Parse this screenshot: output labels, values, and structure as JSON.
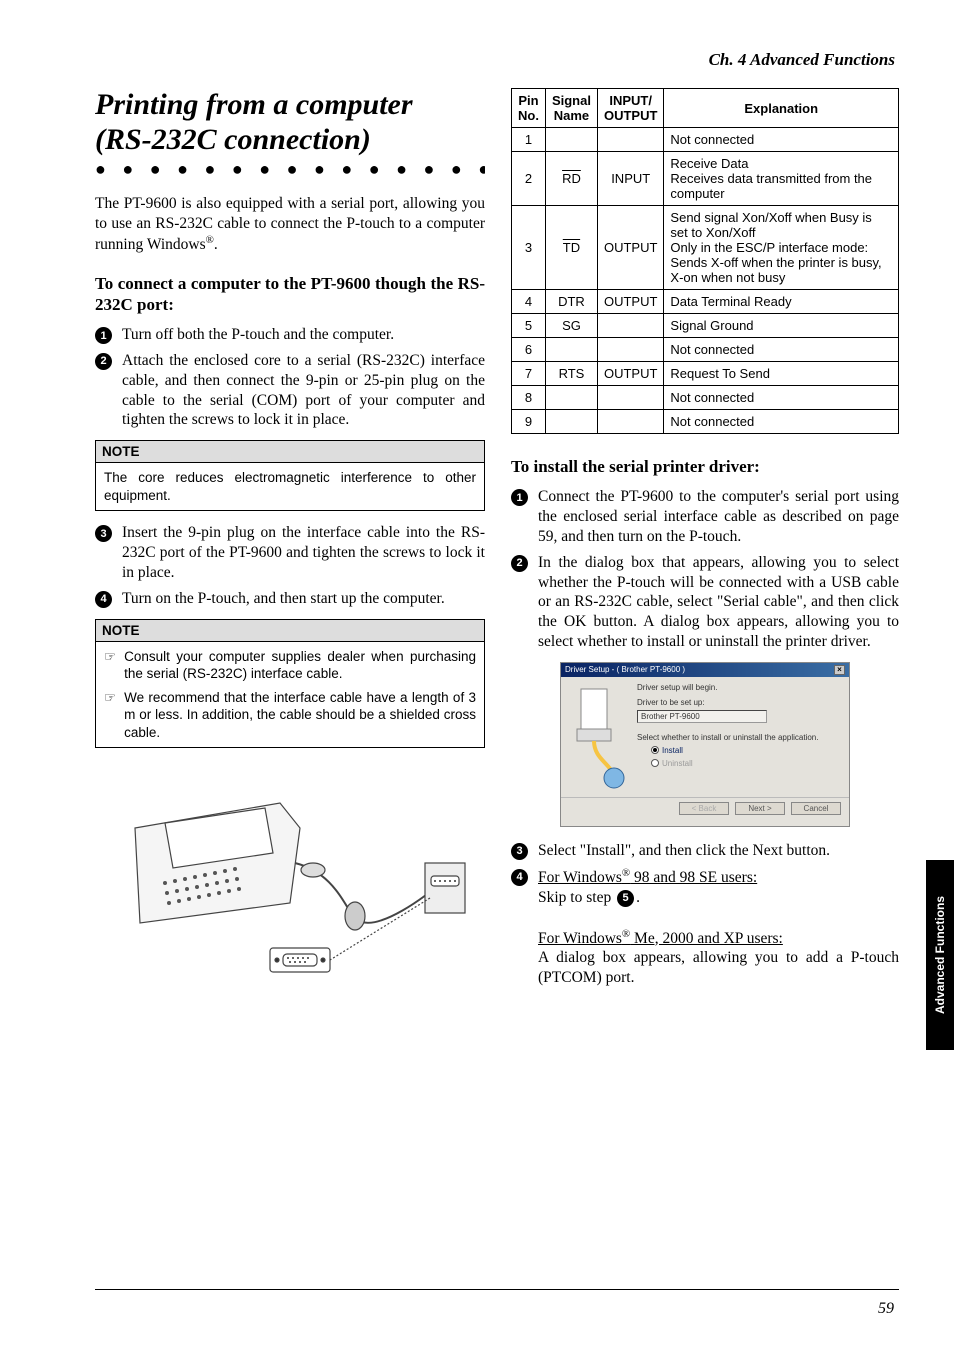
{
  "chapter_header": "Ch. 4 Advanced Functions",
  "title_l1": "Printing from a computer",
  "title_l2": "(RS-232C connection)",
  "intro_body": "The PT-9600 is also equipped with a serial port, allowing you to use an RS-232C cable to connect the P-touch to a computer running Windows",
  "intro_sup": "®",
  "intro_tail": ".",
  "sub1": "To connect a computer to the PT-9600 though the RS-232C port:",
  "steps_a": {
    "s1": "Turn off both the P-touch and the computer.",
    "s2": "Attach the enclosed core to a serial (RS-232C) interface cable, and then connect the 9-pin or 25-pin plug on the cable to the serial (COM) port of your computer and tighten the screws to lock it in place."
  },
  "note1_header": "NOTE",
  "note1_body": "The core reduces electromagnetic interference to other equipment.",
  "steps_b": {
    "s3": "Insert the 9-pin plug on the interface cable into the RS-232C port of the PT-9600 and tighten the screws to lock it in place.",
    "s4": "Turn on the P-touch, and then start up the computer."
  },
  "note2_header": "NOTE",
  "note2_items": {
    "i1": "Consult your computer supplies dealer when purchasing the serial (RS-232C) interface cable.",
    "i2": "We recommend that the interface cable have a length of 3 m or less. In addition, the cable should be a shielded cross cable."
  },
  "table": {
    "headers": {
      "h1a": "Pin",
      "h1b": "No.",
      "h2a": "Signal",
      "h2b": "Name",
      "h3a": "INPUT/",
      "h3b": "OUTPUT",
      "h4": "Explanation"
    },
    "rows": [
      {
        "pin": "1",
        "sig": "",
        "io": "",
        "exp": "Not connected"
      },
      {
        "pin": "2",
        "sig": "RD",
        "io": "INPUT",
        "exp": "Receive Data\nReceives data transmitted from the computer",
        "overline": true
      },
      {
        "pin": "3",
        "sig": "TD",
        "io": "OUTPUT",
        "exp": "Send signal Xon/Xoff when Busy is set to Xon/Xoff\nOnly in the ESC/P interface mode: Sends X-off when the printer is busy, X-on when not busy",
        "overline": true
      },
      {
        "pin": "4",
        "sig": "DTR",
        "io": "OUTPUT",
        "exp": "Data Terminal Ready"
      },
      {
        "pin": "5",
        "sig": "SG",
        "io": "",
        "exp": "Signal Ground"
      },
      {
        "pin": "6",
        "sig": "",
        "io": "",
        "exp": "Not connected"
      },
      {
        "pin": "7",
        "sig": "RTS",
        "io": "OUTPUT",
        "exp": "Request To Send"
      },
      {
        "pin": "8",
        "sig": "",
        "io": "",
        "exp": "Not connected"
      },
      {
        "pin": "9",
        "sig": "",
        "io": "",
        "exp": "Not connected"
      }
    ]
  },
  "sub2": "To install the serial printer driver:",
  "steps_c": {
    "s1": "Connect the PT-9600 to the computer's serial port using the enclosed serial interface cable as described on page 59, and then turn on the P-touch.",
    "s2": "In the dialog box that appears, allowing you to select whether the P-touch will be connected with a USB cable or an RS-232C cable, select \"Serial cable\", and then click the OK button. A dialog box appears, allowing you to select whether to install or uninstall the printer driver.",
    "s3": "Select \"Install\", and then click the Next button.",
    "s4_head_a": "For Windows",
    "s4_head_b": " 98 and 98 SE users:",
    "s4_body1": "Skip to step ",
    "s4_body1_tail": ".",
    "s4_head_c": "For Windows",
    "s4_head_d": " Me, 2000 and XP users:",
    "s4_body2": "A dialog box appears, allowing you to add a P-touch (PTCOM) port."
  },
  "screenshot": {
    "title": "Driver Setup - ( Brother PT-9600 )",
    "l1": "Driver setup will begin.",
    "l2": "Driver to be set up:",
    "l3": "Brother PT-9600",
    "l4": "Select whether to install or uninstall the application.",
    "r1": "Install",
    "r2": "Uninstall",
    "b1": "< Back",
    "b2": "Next >",
    "b3": "Cancel"
  },
  "side_tab": "Advanced Functions",
  "page_num": "59"
}
